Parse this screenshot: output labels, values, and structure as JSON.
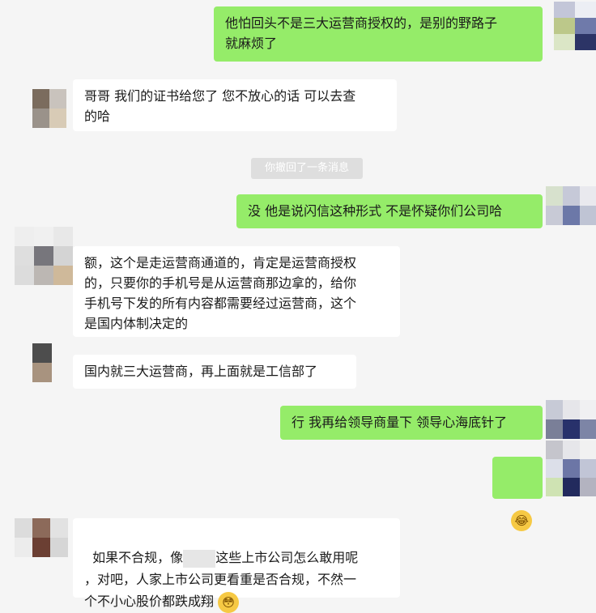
{
  "messages": [
    {
      "text": "他怕回头不是三大运营商授权的，是别的野路子\n就麻烦了"
    },
    {
      "text": "哥哥 我们的证书给您了 您不放心的话 可以去查\n的哈"
    },
    {
      "text": "没 他是说闪信这种形式 不是怀疑你们公司哈"
    },
    {
      "text": "额，这个是走运营商通道的，肯定是运营商授权\n的，只要你的手机号是从运营商那边拿的，给你\n手机号下发的所有内容都需要经过运营商，这个\n是国内体制决定的"
    },
    {
      "text": "国内就三大运营商，再上面就是工信部了"
    },
    {
      "text": "行 我再给领导商量下 领导心海底针了"
    },
    {
      "text_before": "如果不合规，像",
      "text_after": "这些上市公司怎么敢用呢\n，对吧，人家上市公司更看重是否合规，不然一\n个不小心股价都跌成翔"
    }
  ],
  "system_notice": "你撤回了一条消息",
  "emojis": {
    "sent_sticker": "😂",
    "inline": "😳"
  },
  "colors": {
    "sent_bubble": "#95ec69",
    "received_bubble": "#ffffff",
    "background": "#f5f5f5"
  }
}
